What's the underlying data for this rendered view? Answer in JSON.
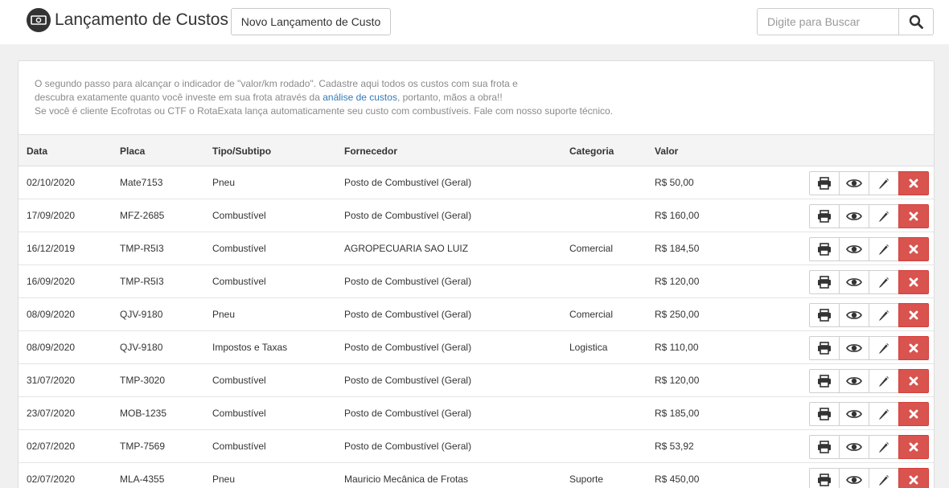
{
  "header": {
    "title": "Lançamento de Custos",
    "new_button_label": "Novo Lançamento de Custo",
    "search_placeholder": "Digite para Buscar",
    "icons": {
      "app": "money-bill-icon",
      "search": "search-icon"
    }
  },
  "info": {
    "line1": "O segundo passo para alcançar o indicador de \"valor/km rodado\". Cadastre aqui todos os custos com sua frota e",
    "line2_before": "descubra exatamente quanto você investe em sua frota através da ",
    "line2_link": "análise de custos",
    "line2_after": ", portanto, mãos a obra!!",
    "line3": "Se você é cliente Ecofrotas ou CTF o RotaExata lança automaticamente seu custo com combustíveis. Fale com nosso suporte técnico."
  },
  "table": {
    "columns": {
      "data": "Data",
      "placa": "Placa",
      "tipo": "Tipo/Subtipo",
      "fornecedor": "Fornecedor",
      "categoria": "Categoria",
      "valor": "Valor"
    },
    "action_icons": [
      "print-icon",
      "eye-icon",
      "pencil-icon",
      "close-icon"
    ],
    "colors": {
      "delete": "#d9534f",
      "link": "#337ab7"
    },
    "rows": [
      {
        "data": "02/10/2020",
        "placa": "Mate7153",
        "tipo": "Pneu",
        "fornecedor": "Posto de Combustível (Geral)",
        "categoria": "",
        "valor": "R$ 50,00"
      },
      {
        "data": "17/09/2020",
        "placa": "MFZ-2685",
        "tipo": "Combustível",
        "fornecedor": "Posto de Combustível (Geral)",
        "categoria": "",
        "valor": "R$ 160,00"
      },
      {
        "data": "16/12/2019",
        "placa": "TMP-R5I3",
        "tipo": "Combustível",
        "fornecedor": "AGROPECUARIA SAO LUIZ",
        "categoria": "Comercial",
        "valor": "R$ 184,50"
      },
      {
        "data": "16/09/2020",
        "placa": "TMP-R5I3",
        "tipo": "Combustível",
        "fornecedor": "Posto de Combustível (Geral)",
        "categoria": "",
        "valor": "R$ 120,00"
      },
      {
        "data": "08/09/2020",
        "placa": "QJV-9180",
        "tipo": "Pneu",
        "fornecedor": "Posto de Combustível (Geral)",
        "categoria": "Comercial",
        "valor": "R$ 250,00"
      },
      {
        "data": "08/09/2020",
        "placa": "QJV-9180",
        "tipo": "Impostos e Taxas",
        "fornecedor": "Posto de Combustível (Geral)",
        "categoria": "Logistica",
        "valor": "R$ 110,00"
      },
      {
        "data": "31/07/2020",
        "placa": "TMP-3020",
        "tipo": "Combustível",
        "fornecedor": "Posto de Combustível (Geral)",
        "categoria": "",
        "valor": "R$ 120,00"
      },
      {
        "data": "23/07/2020",
        "placa": "MOB-1235",
        "tipo": "Combustível",
        "fornecedor": "Posto de Combustível (Geral)",
        "categoria": "",
        "valor": "R$ 185,00"
      },
      {
        "data": "02/07/2020",
        "placa": "TMP-7569",
        "tipo": "Combustível",
        "fornecedor": "Posto de Combustível (Geral)",
        "categoria": "",
        "valor": "R$ 53,92"
      },
      {
        "data": "02/07/2020",
        "placa": "MLA-4355",
        "tipo": "Pneu",
        "fornecedor": "Mauricio Mecânica de Frotas",
        "categoria": "Suporte",
        "valor": "R$ 450,00"
      }
    ]
  }
}
